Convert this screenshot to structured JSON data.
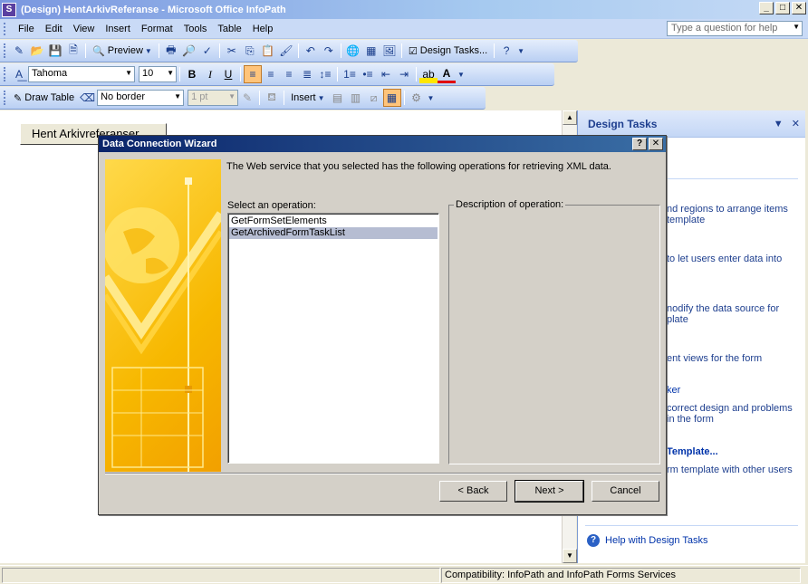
{
  "window": {
    "title": "(Design) HentArkivReferanse - Microsoft Office InfoPath",
    "help_placeholder": "Type a question for help"
  },
  "menu": [
    "File",
    "Edit",
    "View",
    "Insert",
    "Format",
    "Tools",
    "Table",
    "Help"
  ],
  "toolbar": {
    "preview_label": "Preview",
    "design_tasks_label": "Design Tasks...",
    "font_name": "Tahoma",
    "font_size": "10",
    "bold": "B",
    "italic": "I",
    "underline": "U",
    "draw_table_label": "Draw Table",
    "border_style": "No border",
    "border_width": "1 pt",
    "insert_label": "Insert"
  },
  "form": {
    "button_label": "Hent Arkivreferanser"
  },
  "task_pane": {
    "title": "Design Tasks",
    "items": [
      {
        "text": "nd regions to arrange items template",
        "kind": "desc"
      },
      {
        "text": "to let users enter data into",
        "kind": "desc"
      },
      {
        "text": "nodify the data source for plate",
        "kind": "desc"
      },
      {
        "text": "ent views for the form",
        "kind": "desc"
      },
      {
        "text": "ker",
        "kind": "link"
      },
      {
        "text": "correct design and problems in the form",
        "kind": "desc"
      },
      {
        "text": "Template...",
        "kind": "link"
      },
      {
        "text": "rm template with other users",
        "kind": "desc"
      }
    ],
    "help_link": "Help with Design Tasks"
  },
  "status": {
    "compatibility": "Compatibility: InfoPath and InfoPath Forms Services"
  },
  "dialog": {
    "title": "Data Connection Wizard",
    "intro": "The Web service that you selected has the following operations for retrieving XML data.",
    "select_label": "Select an operation:",
    "operations": [
      "GetFormSetElements",
      "GetArchivedFormTaskList"
    ],
    "selected_operation": "GetArchivedFormTaskList",
    "description_label": "Description of operation:",
    "back_label": "< Back",
    "next_label": "Next >",
    "cancel_label": "Cancel"
  },
  "colors": {
    "title_gradient": "#7a96df",
    "dialog_title": "#0a246a",
    "wizard_art": "#f7b800",
    "selection": "#b6bdd2",
    "task_header_text": "#1e3f8f"
  }
}
